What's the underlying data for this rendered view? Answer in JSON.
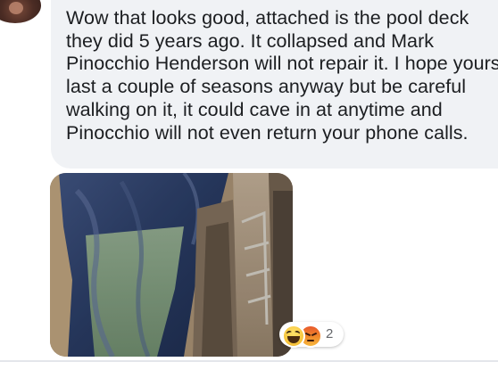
{
  "comment": {
    "text": "Wow that looks good, attached is the pool deck they did 5 years ago. It collapsed and Mark Pinocchio Henderson will not repair it. I hope yours last a couple of seasons anyway but be careful walking on it, it could cave in at anytime and Pinocchio will not even return your phone calls."
  },
  "reactions": {
    "icons": [
      "haha-icon",
      "angry-icon"
    ],
    "count": "2"
  },
  "colors": {
    "bubble_background": "#f0f2f5",
    "text": "#1c1e21",
    "count_text": "#65676b"
  }
}
